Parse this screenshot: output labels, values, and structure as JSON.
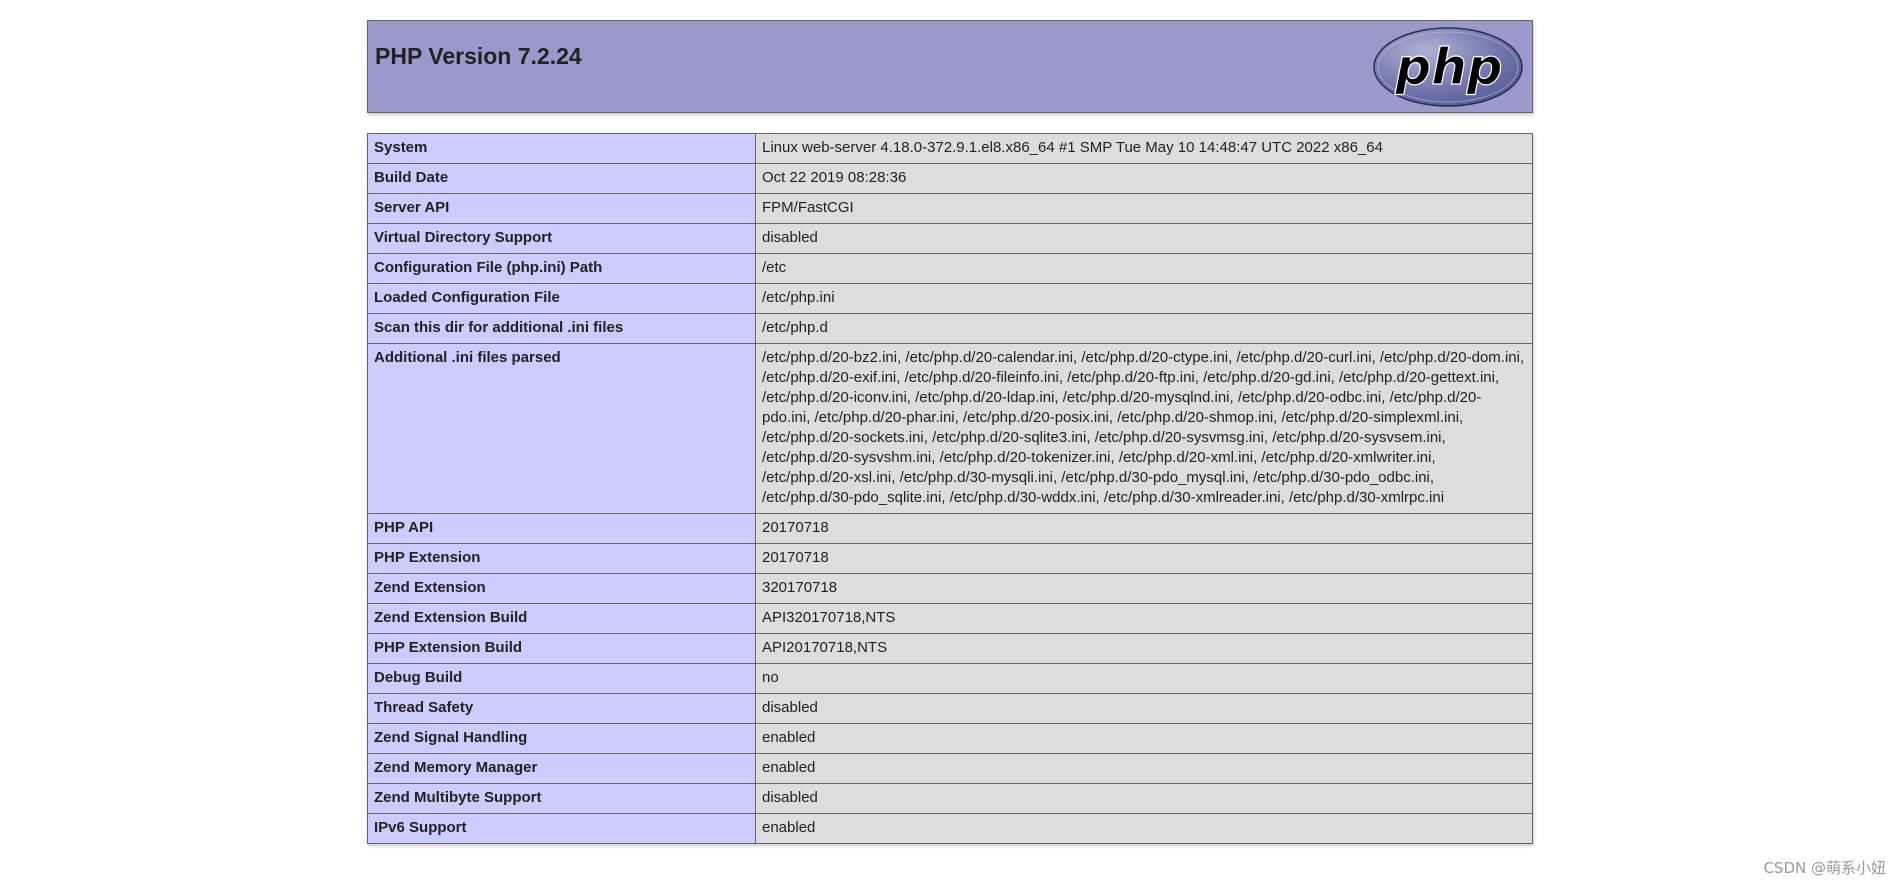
{
  "header": {
    "title": "PHP Version 7.2.24",
    "logo_text": "php",
    "bg_color": "#9999cc"
  },
  "colors": {
    "key_cell": "#ccccff",
    "value_cell": "#dddddd",
    "border": "#666666"
  },
  "rows": [
    {
      "key": "System",
      "value": "Linux web-server 4.18.0-372.9.1.el8.x86_64 #1 SMP Tue May 10 14:48:47 UTC 2022 x86_64"
    },
    {
      "key": "Build Date",
      "value": "Oct 22 2019 08:28:36"
    },
    {
      "key": "Server API",
      "value": "FPM/FastCGI"
    },
    {
      "key": "Virtual Directory Support",
      "value": "disabled"
    },
    {
      "key": "Configuration File (php.ini) Path",
      "value": "/etc"
    },
    {
      "key": "Loaded Configuration File",
      "value": "/etc/php.ini"
    },
    {
      "key": "Scan this dir for additional .ini files",
      "value": "/etc/php.d"
    },
    {
      "key": "Additional .ini files parsed",
      "value": "/etc/php.d/20-bz2.ini, /etc/php.d/20-calendar.ini, /etc/php.d/20-ctype.ini, /etc/php.d/20-curl.ini, /etc/php.d/20-dom.ini, /etc/php.d/20-exif.ini, /etc/php.d/20-fileinfo.ini, /etc/php.d/20-ftp.ini, /etc/php.d/20-gd.ini, /etc/php.d/20-gettext.ini, /etc/php.d/20-iconv.ini, /etc/php.d/20-ldap.ini, /etc/php.d/20-mysqlnd.ini, /etc/php.d/20-odbc.ini, /etc/php.d/20-pdo.ini, /etc/php.d/20-phar.ini, /etc/php.d/20-posix.ini, /etc/php.d/20-shmop.ini, /etc/php.d/20-simplexml.ini, /etc/php.d/20-sockets.ini, /etc/php.d/20-sqlite3.ini, /etc/php.d/20-sysvmsg.ini, /etc/php.d/20-sysvsem.ini, /etc/php.d/20-sysvshm.ini, /etc/php.d/20-tokenizer.ini, /etc/php.d/20-xml.ini, /etc/php.d/20-xmlwriter.ini, /etc/php.d/20-xsl.ini, /etc/php.d/30-mysqli.ini, /etc/php.d/30-pdo_mysql.ini, /etc/php.d/30-pdo_odbc.ini, /etc/php.d/30-pdo_sqlite.ini, /etc/php.d/30-wddx.ini, /etc/php.d/30-xmlreader.ini, /etc/php.d/30-xmlrpc.ini"
    },
    {
      "key": "PHP API",
      "value": "20170718"
    },
    {
      "key": "PHP Extension",
      "value": "20170718"
    },
    {
      "key": "Zend Extension",
      "value": "320170718"
    },
    {
      "key": "Zend Extension Build",
      "value": "API320170718,NTS"
    },
    {
      "key": "PHP Extension Build",
      "value": "API20170718,NTS"
    },
    {
      "key": "Debug Build",
      "value": "no"
    },
    {
      "key": "Thread Safety",
      "value": "disabled"
    },
    {
      "key": "Zend Signal Handling",
      "value": "enabled"
    },
    {
      "key": "Zend Memory Manager",
      "value": "enabled"
    },
    {
      "key": "Zend Multibyte Support",
      "value": "disabled"
    },
    {
      "key": "IPv6 Support",
      "value": "enabled"
    }
  ],
  "watermark": "CSDN @萌系小妞"
}
